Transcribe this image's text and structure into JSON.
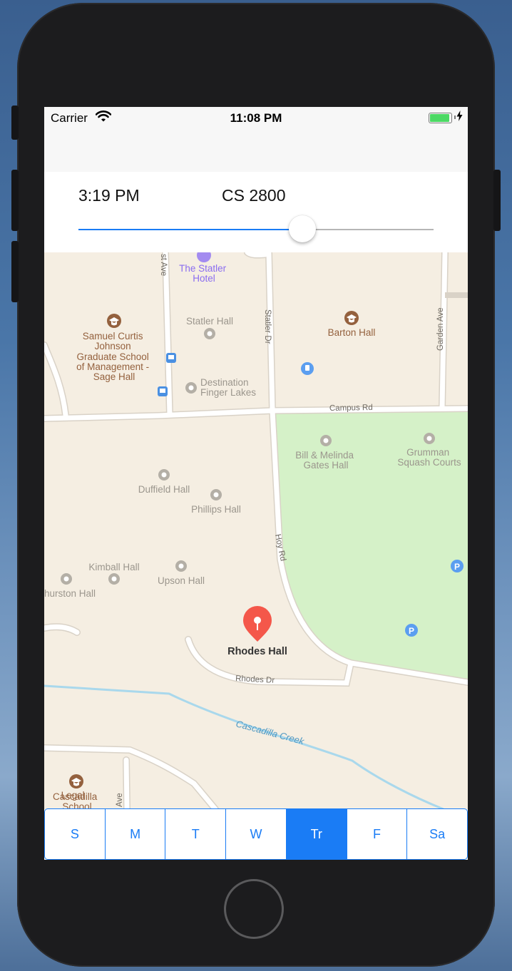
{
  "status_bar": {
    "carrier": "Carrier",
    "time": "11:08 PM",
    "battery_percent": 100
  },
  "header": {
    "time": "3:19 PM",
    "course": "CS 2800"
  },
  "slider": {
    "value_fraction": 0.63
  },
  "map": {
    "labels": {
      "statler_hotel": [
        "The Statler",
        "Hotel"
      ],
      "sage_hall": [
        "Samuel Curtis",
        "Johnson",
        "Graduate School",
        "of Management -",
        "Sage Hall"
      ],
      "statler_hall": "Statler Hall",
      "barton_hall": "Barton Hall",
      "destination": [
        "Destination",
        "Finger Lakes"
      ],
      "gates_hall": [
        "Bill & Melinda",
        "Gates Hall"
      ],
      "grumman": [
        "Grumman",
        "Squash Courts"
      ],
      "duffield": "Duffield Hall",
      "phillips": "Phillips Hall",
      "kimball": "Kimball Hall",
      "upson": "Upson Hall",
      "thurston": "hurston Hall",
      "rhodes": "Rhodes Hall",
      "law_school": [
        "Legal",
        "Cascadilla",
        "School"
      ],
      "creek": "Cascadilla Creek"
    },
    "streets": {
      "statler_dr": "Statler Dr",
      "garden_ave": "Garden Ave",
      "east_ave": "st Ave",
      "campus_rd": "Campus Rd",
      "hoy_rd": "Hoy Rd",
      "rhodes_dr": "Rhodes Dr",
      "college_ave": "Ave"
    },
    "parking_label": "P",
    "colors": {
      "land": "#f5eee2",
      "park": "#d5f1c8",
      "road": "#ffffff",
      "road_edge": "#d9d2c7",
      "water": "#a9d8ec",
      "poi_label": "#94613e",
      "pin": "#f4574a",
      "accent": "#1a7cf5"
    }
  },
  "days": [
    {
      "label": "S",
      "selected": false
    },
    {
      "label": "M",
      "selected": false
    },
    {
      "label": "T",
      "selected": false
    },
    {
      "label": "W",
      "selected": false
    },
    {
      "label": "Tr",
      "selected": true
    },
    {
      "label": "F",
      "selected": false
    },
    {
      "label": "Sa",
      "selected": false
    }
  ]
}
